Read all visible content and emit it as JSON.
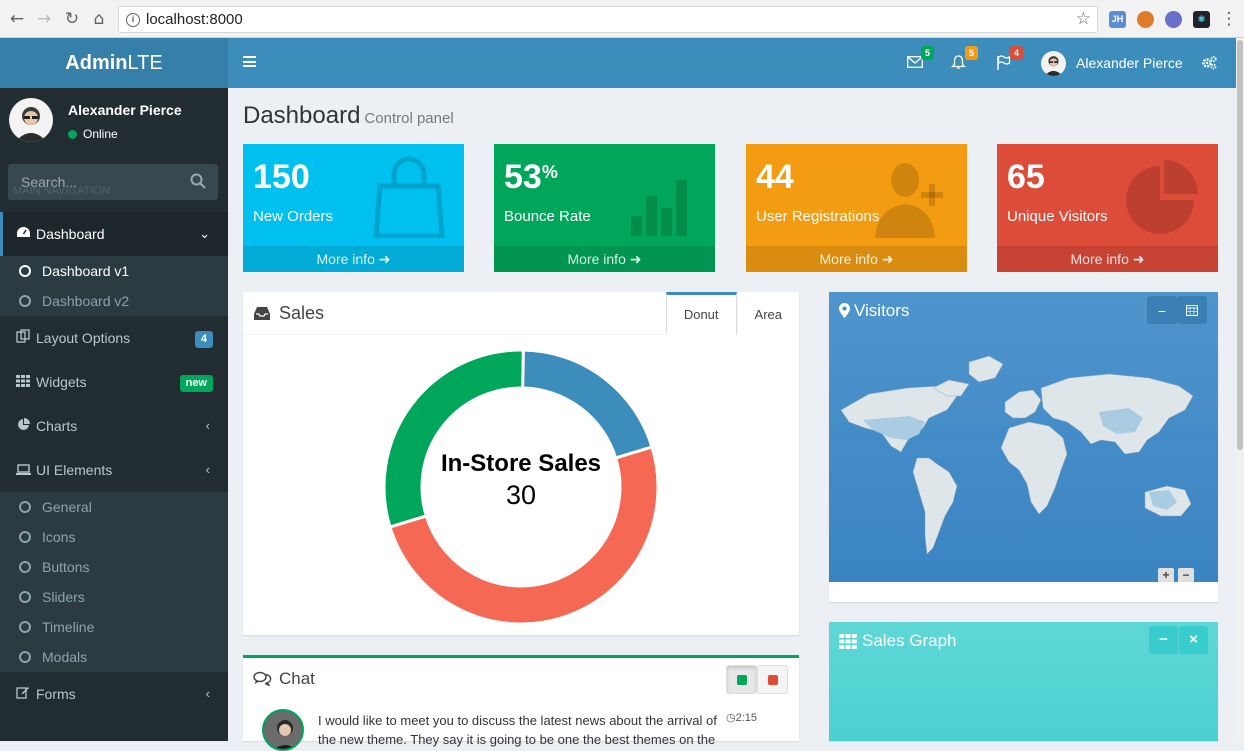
{
  "browser": {
    "url": "localhost:8000",
    "extensions": [
      "JH",
      "pi",
      "Ws",
      "re"
    ]
  },
  "brand": {
    "bold": "Admin",
    "light": "LTE"
  },
  "user": {
    "name": "Alexander Pierce",
    "status": "Online"
  },
  "search": {
    "placeholder": "Search..."
  },
  "sidebar": {
    "header": "MAIN NAVIGATION",
    "dashboard": {
      "label": "Dashboard",
      "sub": [
        "Dashboard v1",
        "Dashboard v2"
      ]
    },
    "layout": {
      "label": "Layout Options",
      "badge": "4"
    },
    "widgets": {
      "label": "Widgets",
      "badge": "new"
    },
    "charts": {
      "label": "Charts"
    },
    "ui": {
      "label": "UI Elements",
      "sub": [
        "General",
        "Icons",
        "Buttons",
        "Sliders",
        "Timeline",
        "Modals"
      ]
    },
    "forms": {
      "label": "Forms"
    }
  },
  "topbar": {
    "messages": "5",
    "notifications": "5",
    "tasks": "4"
  },
  "page": {
    "title": "Dashboard",
    "subtitle": "Control panel"
  },
  "stats": [
    {
      "value": "150",
      "suffix": "",
      "label": "New Orders",
      "more": "More info",
      "color": "#00c0ef",
      "icon": "shopping-bag-icon"
    },
    {
      "value": "53",
      "suffix": "%",
      "label": "Bounce Rate",
      "more": "More info",
      "color": "#00a65a",
      "icon": "bar-chart-icon"
    },
    {
      "value": "44",
      "suffix": "",
      "label": "User Registrations",
      "more": "More info",
      "color": "#f39c12",
      "icon": "user-add-icon"
    },
    {
      "value": "65",
      "suffix": "",
      "label": "Unique Visitors",
      "more": "More info",
      "color": "#dd4b39",
      "icon": "pie-chart-icon"
    }
  ],
  "sales": {
    "title": "Sales",
    "tabs": [
      "Donut",
      "Area"
    ],
    "center_label": "In-Store Sales",
    "center_value": "30"
  },
  "chart_data": {
    "type": "pie",
    "series": [
      {
        "name": "In-Store Sales",
        "value": 30,
        "color": "#00a65a"
      },
      {
        "value": 20,
        "color": "#3c8dbc"
      },
      {
        "value": 50,
        "color": "#f56954"
      }
    ]
  },
  "visitors": {
    "title": "Visitors"
  },
  "sales_graph": {
    "title": "Sales Graph"
  },
  "chat": {
    "title": "Chat",
    "time": "2:15",
    "message": "I would like to meet you to discuss the latest news about the arrival of the new theme. They say it is going to be one the best themes on the"
  },
  "colors": {
    "primary": "#3c8dbc",
    "sidebar": "#222d32",
    "success": "#00a65a",
    "danger": "#dd4b39",
    "warning": "#f39c12",
    "info": "#00c0ef"
  }
}
